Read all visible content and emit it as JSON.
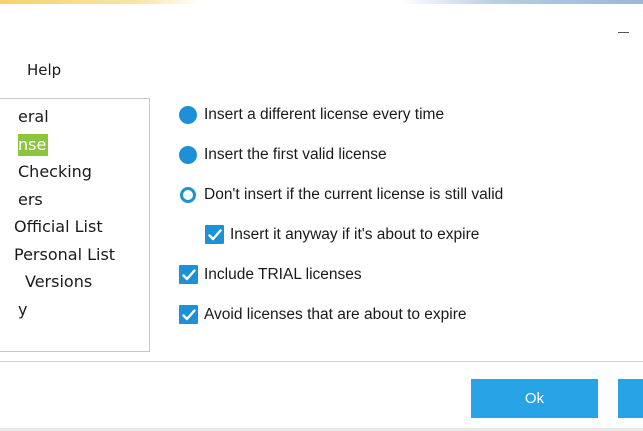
{
  "menu": {
    "items": [
      "Help"
    ]
  },
  "nav": {
    "items": [
      {
        "label": "eral",
        "selected": false
      },
      {
        "label": "nse",
        "selected": true
      },
      {
        "label": "Checking",
        "selected": false
      },
      {
        "label": "ers",
        "selected": false
      },
      {
        "label": "Official List",
        "selected": false
      },
      {
        "label": "Personal List",
        "selected": false
      },
      {
        "label": "Versions",
        "selected": false
      },
      {
        "label": "y",
        "selected": false
      }
    ],
    "selected_color": "#8cc63f"
  },
  "options": {
    "radio_different": {
      "label": "Insert a different license every time",
      "checked": false
    },
    "radio_first_valid": {
      "label": "Insert the first valid license",
      "checked": false
    },
    "radio_dont_insert": {
      "label": "Don't insert if the current license is still valid",
      "checked": true
    },
    "check_insert_anyway": {
      "label": "Insert it anyway if it's about to expire",
      "checked": true
    },
    "check_include_trial": {
      "label": "Include TRIAL licenses",
      "checked": true
    },
    "check_avoid_expiring": {
      "label": "Avoid licenses that are about to expire",
      "checked": true
    }
  },
  "footer": {
    "ok_label": "Ok"
  },
  "colors": {
    "accent": "#1e90d6",
    "button": "#28a3e5",
    "selection": "#8cc63f"
  },
  "icons": {
    "minimize": "minimize-icon",
    "radio": "radio-icon",
    "checkbox": "checkbox-icon"
  }
}
